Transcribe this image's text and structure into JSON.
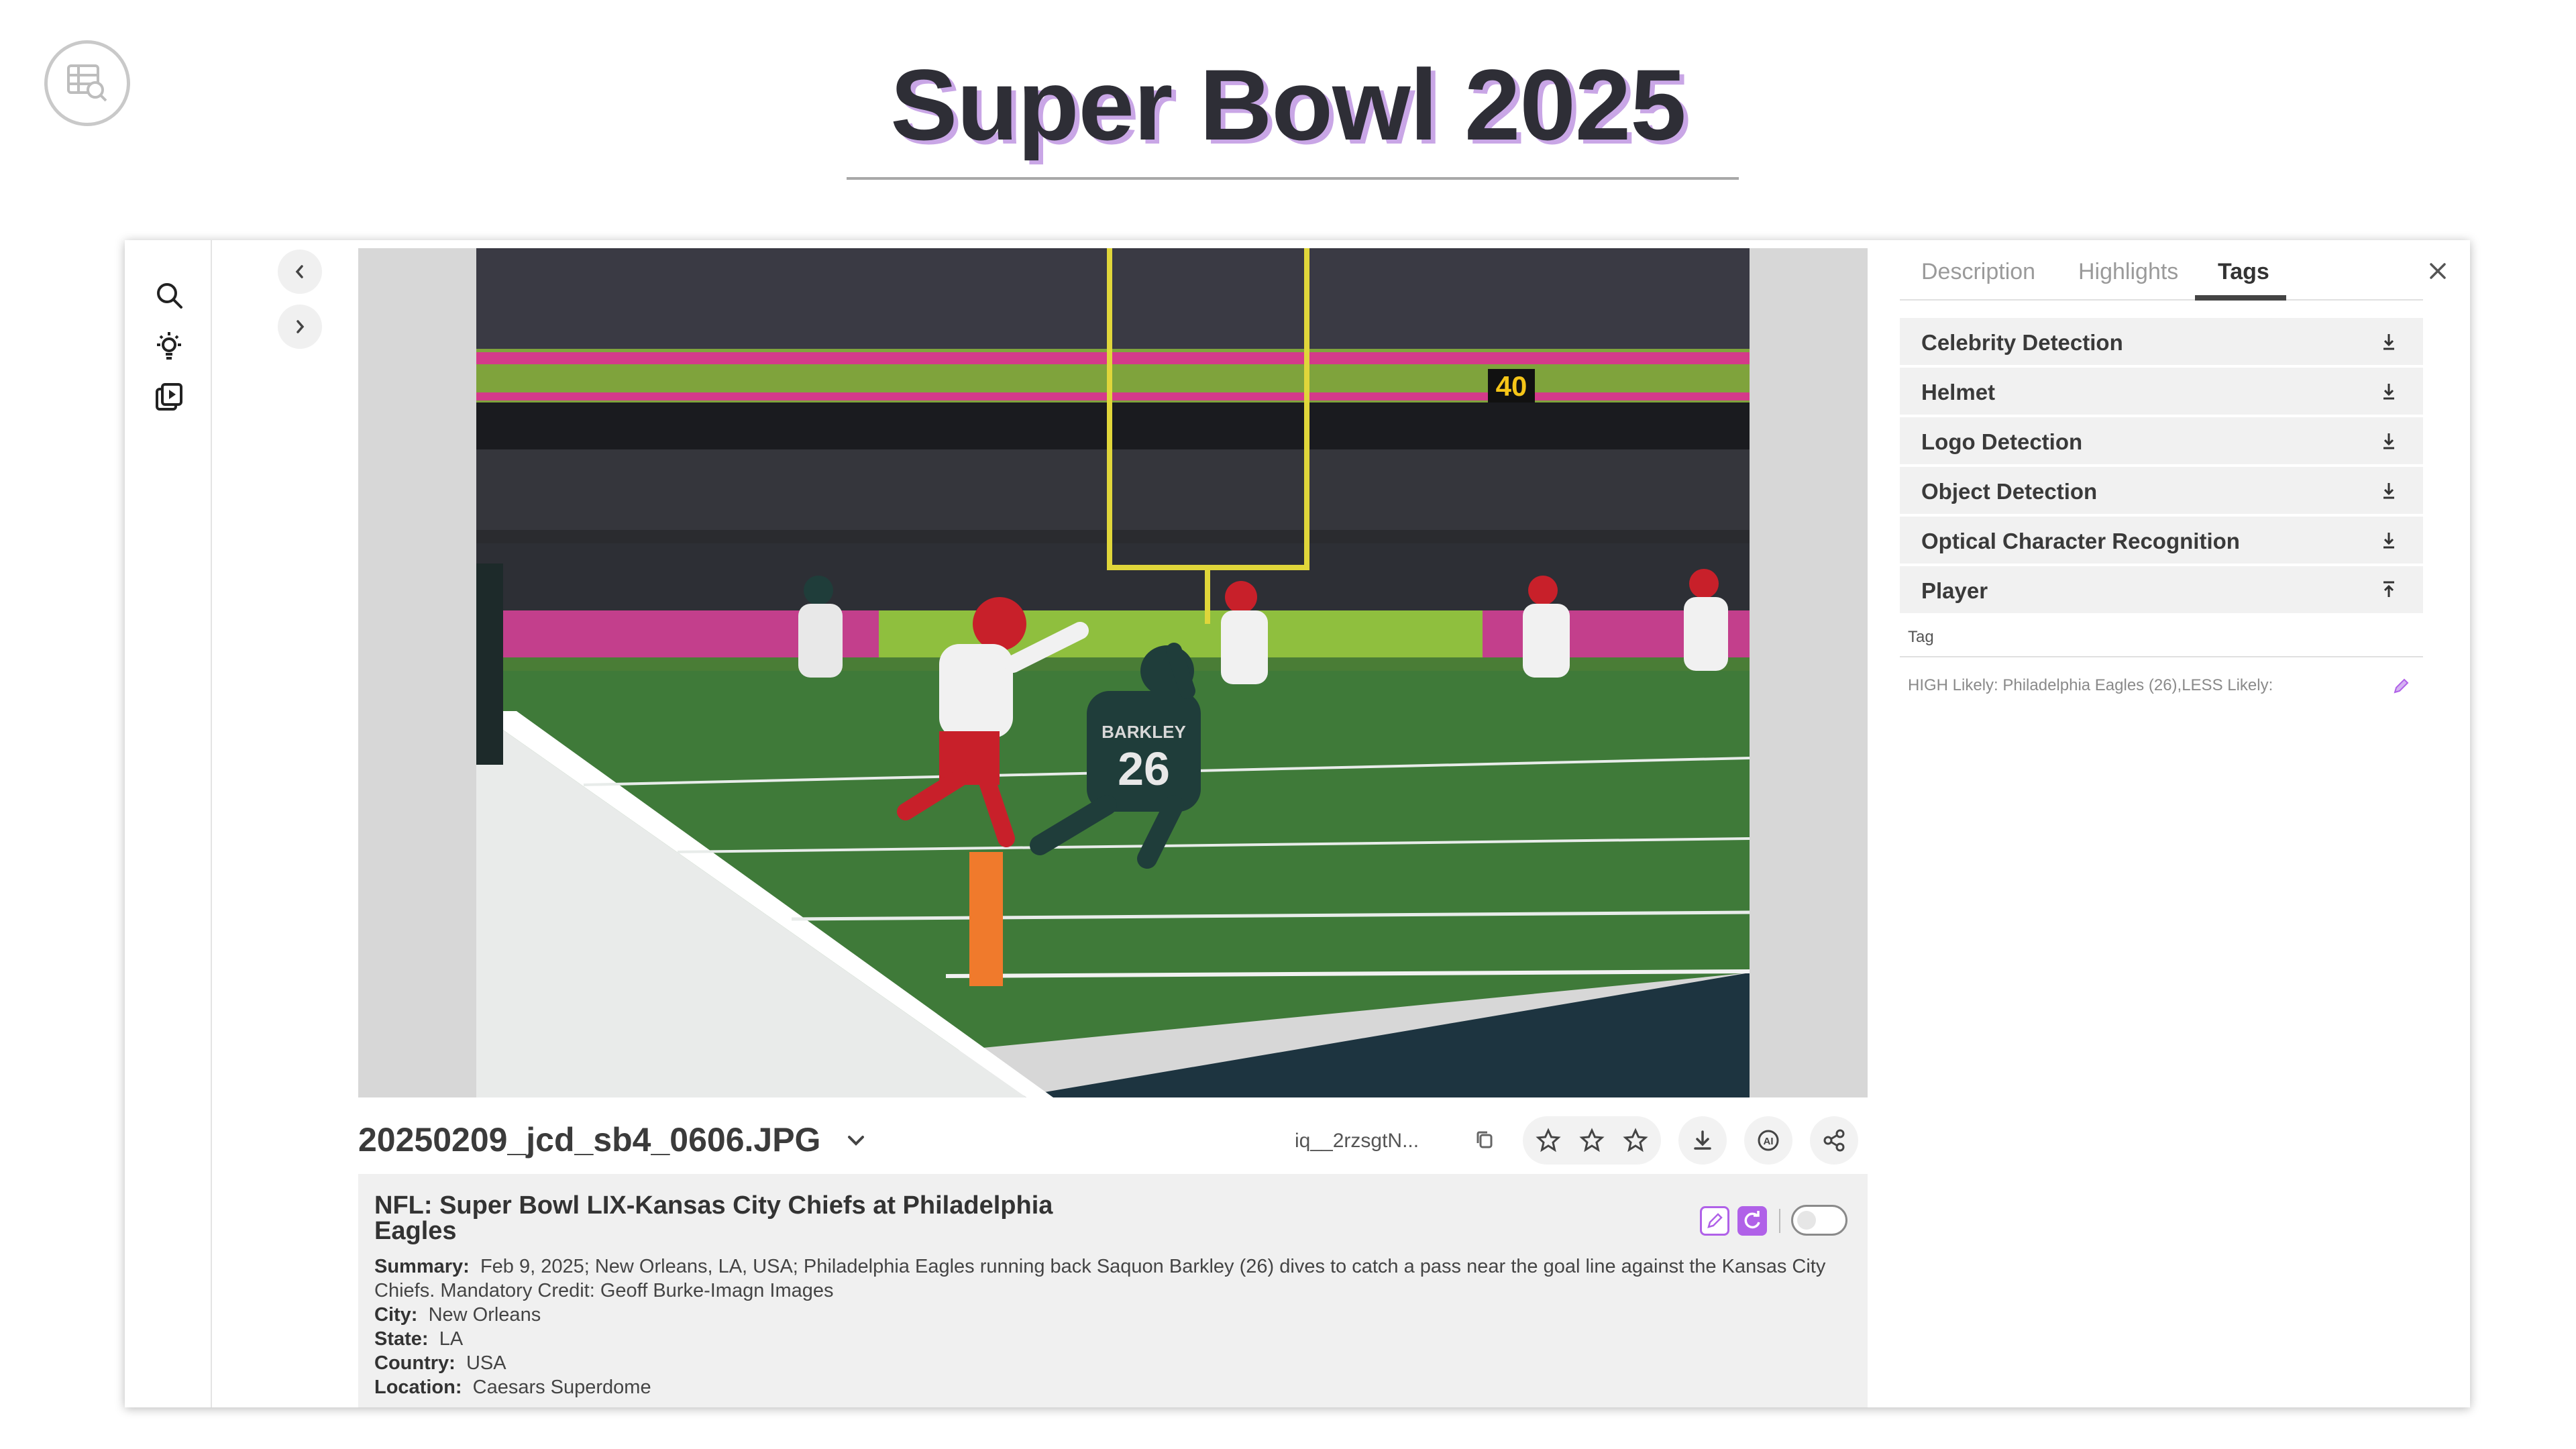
{
  "slide": {
    "title": "Super Bowl 2025"
  },
  "file": {
    "name": "20250209_jcd_sb4_0606.JPG",
    "id_short": "iq__2rzsgtN..."
  },
  "metadata": {
    "headline": "NFL: Super Bowl LIX-Kansas City Chiefs at Philadelphia Eagles",
    "fields": [
      {
        "label": "Summary:",
        "value": "Feb 9, 2025; New Orleans, LA, USA; Philadelphia Eagles running back Saquon Barkley (26) dives to catch a pass near the goal line against the Kansas City Chiefs. Mandatory Credit: Geoff Burke-Imagn Images"
      },
      {
        "label": "City:",
        "value": "New Orleans"
      },
      {
        "label": "State:",
        "value": "LA"
      },
      {
        "label": "Country:",
        "value": "USA"
      },
      {
        "label": "Location:",
        "value": "Caesars Superdome"
      }
    ]
  },
  "panel": {
    "tabs": [
      {
        "label": "Description",
        "active": false
      },
      {
        "label": "Highlights",
        "active": false
      },
      {
        "label": "Tags",
        "active": true
      }
    ],
    "tag_groups": [
      {
        "label": "Celebrity Detection",
        "icon": "download-icon"
      },
      {
        "label": "Helmet",
        "icon": "download-icon"
      },
      {
        "label": "Logo Detection",
        "icon": "download-icon"
      },
      {
        "label": "Object Detection",
        "icon": "download-icon"
      },
      {
        "label": "Optical Character Recognition",
        "icon": "download-icon"
      },
      {
        "label": "Player",
        "icon": "upload-icon"
      }
    ],
    "tag_table": {
      "header": "Tag",
      "value": "HIGH Likely: Philadelphia Eagles (26),LESS Likely:"
    }
  },
  "photo": {
    "scoreboard": "40",
    "jersey_name": "BARKLEY",
    "jersey_number": "26"
  },
  "colors": {
    "accent": "#b061e8",
    "title_shadow": "#c9a6e6",
    "field_green": "#3f7a39"
  }
}
